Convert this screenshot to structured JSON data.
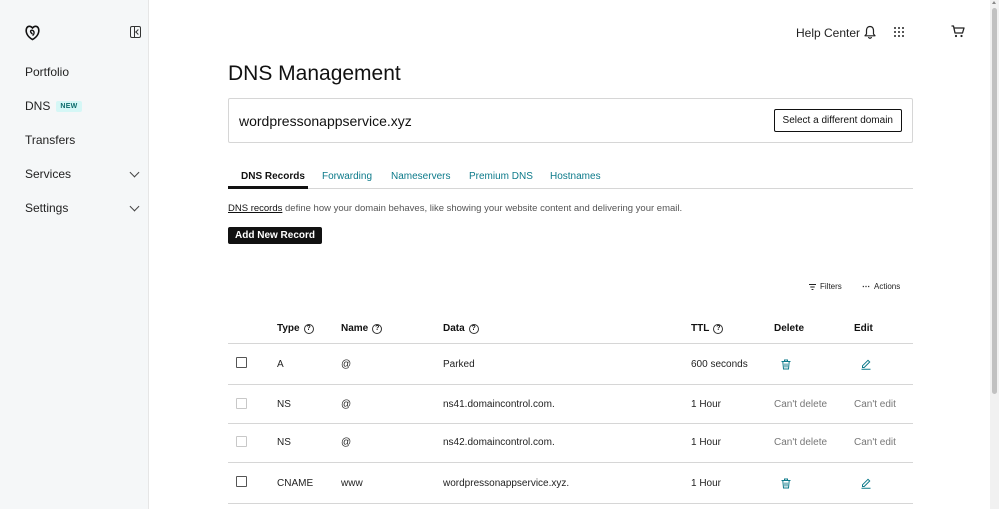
{
  "sidebar": {
    "items": [
      {
        "label": "Portfolio"
      },
      {
        "label": "DNS",
        "badge": "NEW"
      },
      {
        "label": "Transfers"
      },
      {
        "label": "Services"
      },
      {
        "label": "Settings"
      }
    ]
  },
  "topbar": {
    "help_label": "Help Center"
  },
  "main": {
    "title": "DNS Management",
    "domain": "wordpressonappservice.xyz",
    "select_domain_label": "Select a different domain",
    "tabs": [
      {
        "label": "DNS Records",
        "active": true
      },
      {
        "label": "Forwarding"
      },
      {
        "label": "Nameservers"
      },
      {
        "label": "Premium DNS"
      },
      {
        "label": "Hostnames"
      }
    ],
    "description_link": "DNS records",
    "description_text": " define how your domain behaves, like showing your website content and delivering your email.",
    "add_record_label": "Add New Record",
    "filters_label": "Filters",
    "actions_label": "Actions"
  },
  "table": {
    "headers": {
      "type": "Type",
      "name": "Name",
      "data": "Data",
      "ttl": "TTL",
      "delete": "Delete",
      "edit": "Edit"
    },
    "rows": [
      {
        "type": "A",
        "name": "@",
        "data": "Parked",
        "ttl": "600 seconds",
        "delete": "",
        "edit": ""
      },
      {
        "type": "NS",
        "name": "@",
        "data": "ns41.domaincontrol.com.",
        "ttl": "1 Hour",
        "delete": "Can't delete",
        "edit": "Can't edit"
      },
      {
        "type": "NS",
        "name": "@",
        "data": "ns42.domaincontrol.com.",
        "ttl": "1 Hour",
        "delete": "Can't delete",
        "edit": "Can't edit"
      },
      {
        "type": "CNAME",
        "name": "www",
        "data": "wordpressonappservice.xyz.",
        "ttl": "1 Hour",
        "delete": "",
        "edit": ""
      }
    ]
  },
  "colors": {
    "accent": "#0c7a8a",
    "badge_bg": "#d5f7f6",
    "sidebar_bg": "#f5f7f8"
  },
  "icons": [
    "godaddy-logo-icon",
    "sidebar-collapse-icon",
    "chevron-down-icon",
    "bell-icon",
    "apps-grid-icon",
    "cart-icon",
    "filter-icon",
    "more-dots-icon",
    "help-icon",
    "trash-icon",
    "pencil-icon"
  ]
}
